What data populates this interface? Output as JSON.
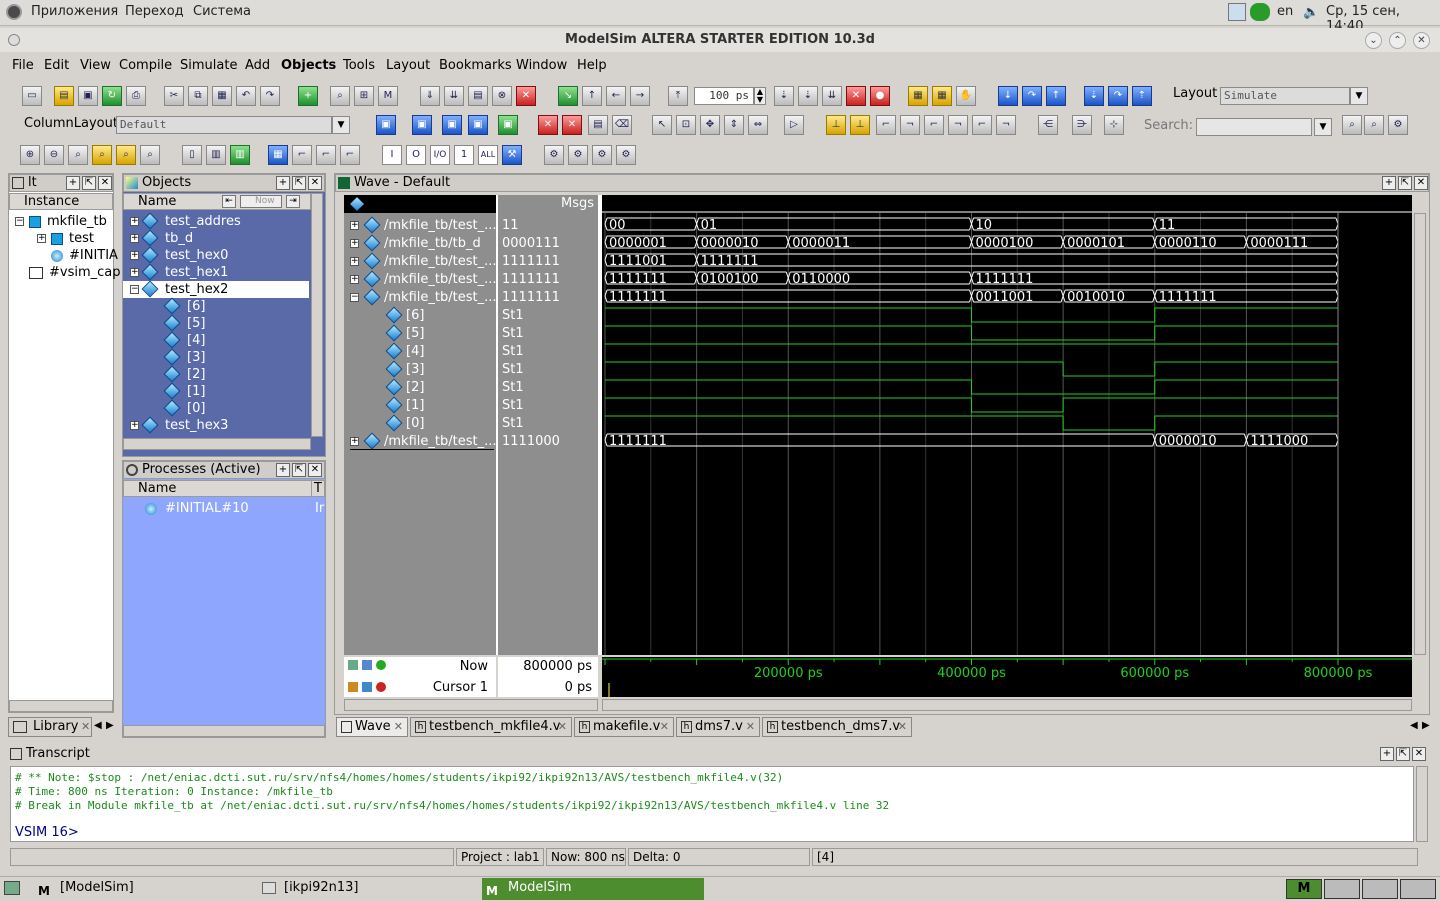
{
  "topbar": {
    "apps_menu": "Приложения",
    "places_menu": "Переход",
    "system_menu": "Система",
    "lang": "en",
    "datetime": "Ср, 15 сен, 14:40"
  },
  "window": {
    "title": "ModelSim ALTERA STARTER EDITION 10.3d"
  },
  "menu": [
    "File",
    "Edit",
    "View",
    "Compile",
    "Simulate",
    "Add",
    "Objects",
    "Tools",
    "Layout",
    "Bookmarks",
    "Window",
    "Help"
  ],
  "toolbar": {
    "run_length": "100 ps",
    "layout_label": "Layout",
    "layout_value": "Simulate",
    "column_layout_label": "ColumnLayout",
    "column_layout_value": "Default",
    "search_label": "Search:",
    "filter_buttons": [
      "I",
      "O",
      "I/O",
      "1",
      "ALL"
    ]
  },
  "instance_pane": {
    "title": "lt",
    "col_instance": "Instance",
    "items": [
      "mkfile_tb",
      "test",
      "#INITIA",
      "#vsim_cap"
    ]
  },
  "objects_pane": {
    "title": "Objects",
    "col_name": "Name",
    "now_btn": "Now",
    "items": [
      "test_addres",
      "tb_d",
      "test_hex0",
      "test_hex1",
      "test_hex2",
      "[6]",
      "[5]",
      "[4]",
      "[3]",
      "[2]",
      "[1]",
      "[0]",
      "test_hex3"
    ]
  },
  "processes_pane": {
    "title": "Processes (Active)",
    "col_name": "Name",
    "col_type": "T",
    "items": [
      {
        "name": "#INITIAL#10",
        "type": "Ir"
      }
    ]
  },
  "wave": {
    "title": "Wave - Default",
    "msgs_header": "Msgs",
    "signals": [
      {
        "name": "/mkfile_tb/test_...",
        "value": "11",
        "expanded": false
      },
      {
        "name": "/mkfile_tb/tb_d",
        "value": "0000111",
        "expanded": false
      },
      {
        "name": "/mkfile_tb/test_...",
        "value": "1111111",
        "expanded": false
      },
      {
        "name": "/mkfile_tb/test_...",
        "value": "1111111",
        "expanded": false
      },
      {
        "name": "/mkfile_tb/test_...",
        "value": "1111111",
        "expanded": true
      },
      {
        "name": "[6]",
        "value": "St1",
        "child": true
      },
      {
        "name": "[5]",
        "value": "St1",
        "child": true
      },
      {
        "name": "[4]",
        "value": "St1",
        "child": true
      },
      {
        "name": "[3]",
        "value": "St1",
        "child": true
      },
      {
        "name": "[2]",
        "value": "St1",
        "child": true
      },
      {
        "name": "[1]",
        "value": "St1",
        "child": true
      },
      {
        "name": "[0]",
        "value": "St1",
        "child": true
      },
      {
        "name": "/mkfile_tb/test_...",
        "value": "1111000",
        "expanded": false
      }
    ],
    "bus_values": [
      [
        "00",
        "01",
        "10",
        "11"
      ],
      [
        "0000001",
        "0000010",
        "0000011",
        "0000100",
        "0000101",
        "0000110",
        "0000111"
      ],
      [
        "1111001",
        "1111111"
      ],
      [
        "1111111",
        "0100100",
        "0110000",
        "1111111"
      ],
      [
        "1111111",
        "0011001",
        "0010010",
        "1111111"
      ],
      [
        "1111111",
        "0000010",
        "1111000"
      ]
    ],
    "now_label": "Now",
    "now_value": "800000 ps",
    "cursor_label": "Cursor 1",
    "cursor_value": "0 ps",
    "time_ticks": [
      "200000 ps",
      "400000 ps",
      "600000 ps",
      "800000 ps"
    ]
  },
  "tabs": {
    "library": "Library",
    "doc_tabs": [
      "Wave",
      "testbench_mkfile4.v",
      "makefile.v",
      "dms7.v",
      "testbench_dms7.v"
    ]
  },
  "transcript": {
    "title": "Transcript",
    "lines": [
      "# ** Note: $stop    : /net/eniac.dcti.sut.ru/srv/nfs4/homes/homes/students/ikpi92/ikpi92n13/AVS/testbench_mkfile4.v(32)",
      "#    Time: 800 ns  Iteration: 0  Instance: /mkfile_tb",
      "# Break in Module mkfile_tb at /net/eniac.dcti.sut.ru/srv/nfs4/homes/homes/students/ikpi92/ikpi92n13/AVS/testbench_mkfile4.v line 32"
    ],
    "prompt": "VSIM 16>"
  },
  "status": {
    "project": "Project : lab1",
    "now": "Now: 800 ns",
    "delta": "Delta: 0",
    "path": "[4]"
  },
  "taskbar": {
    "items": [
      "[ModelSim]",
      "[ikpi92n13]",
      "ModelSim"
    ]
  },
  "colors": {
    "wave_bg": "#000000",
    "wave_signal": "#20d020",
    "objects_selected_bg": "#ffffff",
    "objects_bg": "#5a6aa8",
    "processes_bg": "#8fa6ff"
  }
}
